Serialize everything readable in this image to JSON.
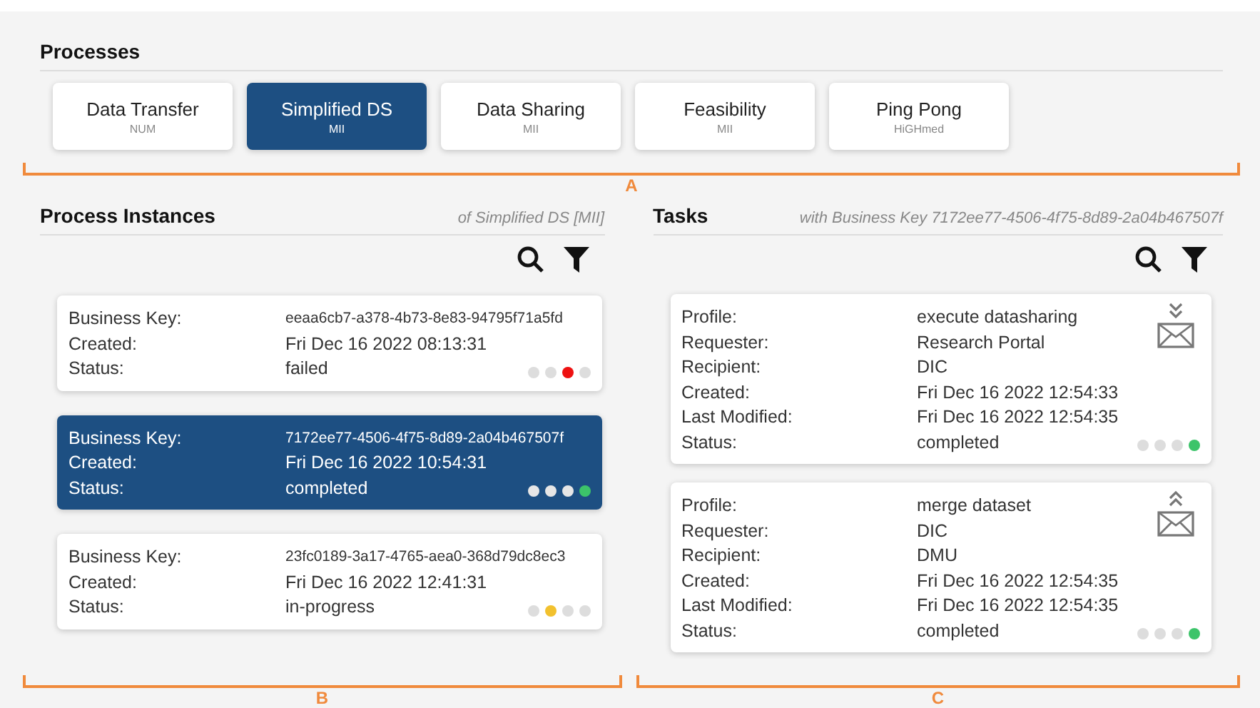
{
  "processes": {
    "title": "Processes",
    "items": [
      {
        "name": "Data Transfer",
        "org": "NUM",
        "selected": false
      },
      {
        "name": "Simplified DS",
        "org": "MII",
        "selected": true
      },
      {
        "name": "Data Sharing",
        "org": "MII",
        "selected": false
      },
      {
        "name": "Feasibility",
        "org": "MII",
        "selected": false
      },
      {
        "name": "Ping Pong",
        "org": "HiGHmed",
        "selected": false
      }
    ],
    "annotation": "A"
  },
  "process_instances": {
    "title": "Process Instances",
    "subtitle": "of Simplified DS [MII]",
    "annotation": "B",
    "items": [
      {
        "selected": false,
        "fields": [
          {
            "label": "Business Key:",
            "value": "eeaa6cb7-a378-4b73-8e83-94795f71a5fd",
            "kind": "key"
          },
          {
            "label": "Created:",
            "value": "Fri Dec 16 2022 08:13:31",
            "kind": "text"
          },
          {
            "label": "Status:",
            "value": "failed",
            "kind": "text"
          }
        ],
        "dots": [
          {
            "color": "#dddddd"
          },
          {
            "color": "#dddddd"
          },
          {
            "color": "#ee1111"
          },
          {
            "color": "#dddddd"
          }
        ]
      },
      {
        "selected": true,
        "fields": [
          {
            "label": "Business Key:",
            "value": "7172ee77-4506-4f75-8d89-2a04b467507f",
            "kind": "key"
          },
          {
            "label": "Created:",
            "value": "Fri Dec 16 2022 10:54:31",
            "kind": "text"
          },
          {
            "label": "Status:",
            "value": "completed",
            "kind": "text"
          }
        ],
        "dots": [
          {
            "color": "#e6e6e6"
          },
          {
            "color": "#e6e6e6"
          },
          {
            "color": "#e6e6e6"
          },
          {
            "color": "#3cc46a"
          }
        ]
      },
      {
        "selected": false,
        "fields": [
          {
            "label": "Business Key:",
            "value": "23fc0189-3a17-4765-aea0-368d79dc8ec3",
            "kind": "key"
          },
          {
            "label": "Created:",
            "value": "Fri Dec 16 2022 12:41:31",
            "kind": "text"
          },
          {
            "label": "Status:",
            "value": "in-progress",
            "kind": "text"
          }
        ],
        "dots": [
          {
            "color": "#dddddd"
          },
          {
            "color": "#f2c12e"
          },
          {
            "color": "#dddddd"
          },
          {
            "color": "#dddddd"
          }
        ]
      }
    ]
  },
  "tasks": {
    "title": "Tasks",
    "subtitle": "with Business Key 7172ee77-4506-4f75-8d89-2a04b467507f",
    "annotation": "C",
    "items": [
      {
        "kind": "down",
        "fields": [
          {
            "label": "Profile:",
            "value": "execute datasharing",
            "kind": "text"
          },
          {
            "label": "Requester:",
            "value": "Research Portal",
            "kind": "text"
          },
          {
            "label": "Recipient:",
            "value": "DIC",
            "kind": "text"
          },
          {
            "label": "Created:",
            "value": "Fri Dec 16 2022 12:54:33",
            "kind": "text"
          },
          {
            "label": "Last Modified:",
            "value": "Fri Dec 16 2022 12:54:35",
            "kind": "text"
          },
          {
            "label": "Status:",
            "value": "completed",
            "kind": "text"
          }
        ],
        "dots": [
          {
            "color": "#dddddd"
          },
          {
            "color": "#dddddd"
          },
          {
            "color": "#dddddd"
          },
          {
            "color": "#3cc46a"
          }
        ]
      },
      {
        "kind": "up",
        "fields": [
          {
            "label": "Profile:",
            "value": "merge dataset",
            "kind": "text"
          },
          {
            "label": "Requester:",
            "value": "DIC",
            "kind": "text"
          },
          {
            "label": "Recipient:",
            "value": "DMU",
            "kind": "text"
          },
          {
            "label": "Created:",
            "value": "Fri Dec 16 2022 12:54:35",
            "kind": "text"
          },
          {
            "label": "Last Modified:",
            "value": "Fri Dec 16 2022 12:54:35",
            "kind": "text"
          },
          {
            "label": "Status:",
            "value": "completed",
            "kind": "text"
          }
        ],
        "dots": [
          {
            "color": "#dddddd"
          },
          {
            "color": "#dddddd"
          },
          {
            "color": "#dddddd"
          },
          {
            "color": "#3cc46a"
          }
        ]
      }
    ]
  }
}
